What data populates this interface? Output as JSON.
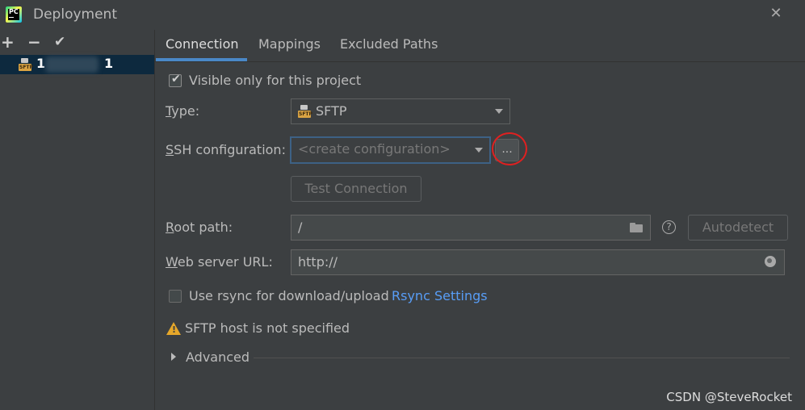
{
  "window": {
    "title": "Deployment",
    "close_glyph": "✕"
  },
  "sidebar": {
    "toolbar": {
      "add": "+",
      "remove": "−",
      "apply": "✔"
    },
    "server": {
      "name_prefix": "1",
      "name_suffix": "1",
      "icon": "sftp-icon",
      "icon_text": "SFTP"
    }
  },
  "tabs": [
    {
      "label": "Connection",
      "selected": true
    },
    {
      "label": "Mappings",
      "selected": false
    },
    {
      "label": "Excluded Paths",
      "selected": false
    }
  ],
  "form": {
    "visible_only": {
      "label": "Visible only for this project",
      "checked": true
    },
    "type": {
      "label_first": "T",
      "label_rest": "ype:",
      "value": "SFTP",
      "icon": "sftp-icon",
      "icon_text": "SFTP"
    },
    "ssh": {
      "label_first": "S",
      "label_rest": "SH configuration:",
      "placeholder": "<create configuration>",
      "more_button": "..."
    },
    "test_connection": "Test Connection",
    "root_path": {
      "label_first": "R",
      "label_rest": "oot path:",
      "value": "/",
      "autodetect": "Autodetect",
      "help": "?"
    },
    "web_server_url": {
      "label_first": "W",
      "label_rest": "eb server URL:",
      "value": "http://"
    },
    "rsync": {
      "label": "Use rsync for download/upload",
      "checked": false,
      "link": "Rsync Settings"
    },
    "warning": "SFTP host is not specified",
    "advanced": "Advanced"
  },
  "colors": {
    "accent": "#4a88c7",
    "link": "#589df6",
    "warning": "#e6a72a",
    "highlight_ring": "#e02020"
  },
  "watermark": "CSDN @SteveRocket"
}
